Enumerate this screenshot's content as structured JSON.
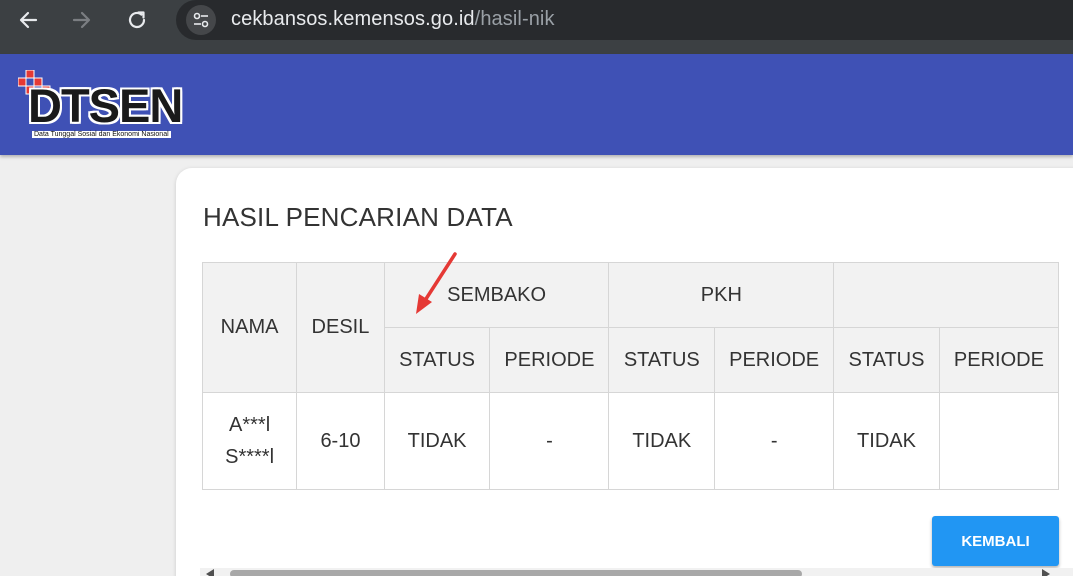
{
  "browser": {
    "url_domain": "cekbansos.kemensos.go.id",
    "url_path": "/hasil-nik"
  },
  "header": {
    "logo_text": "DTSEN",
    "logo_tagline": "Data Tunggal Sosial dan Ekonomi Nasional"
  },
  "main": {
    "title": "HASIL PENCARIAN DATA",
    "table": {
      "col_nama": "NAMA",
      "col_desil": "DESIL",
      "group_sembako": "SEMBAKO",
      "group_pkh": "PKH",
      "sub_status": "STATUS",
      "sub_periode": "PERIODE",
      "row": {
        "nama_line1": "A***l",
        "nama_line2": "S****l",
        "desil": "6-10",
        "sembako_status": "TIDAK",
        "sembako_periode": "-",
        "pkh_status": "TIDAK",
        "pkh_periode": "-",
        "next_status": "TIDAK"
      }
    },
    "back_button": "KEMBALI"
  },
  "colors": {
    "header_bg": "#3f51b5",
    "button_bg": "#2196f3",
    "annotation_arrow": "#e53935"
  }
}
